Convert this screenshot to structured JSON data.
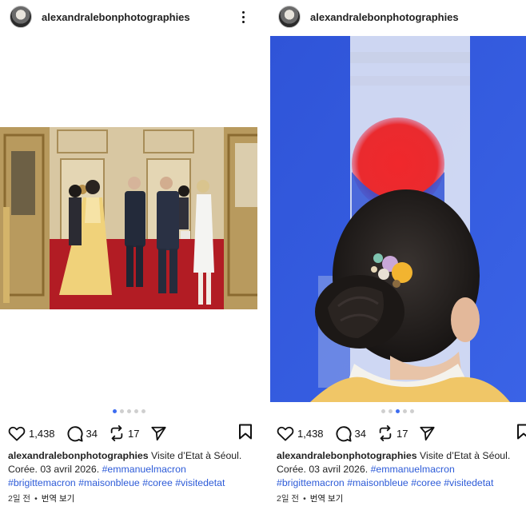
{
  "posts": [
    {
      "username": "alexandralebonphotographies",
      "likes": "1,438",
      "comments": "34",
      "reposts": "17",
      "caption_text": " Visite d’Etat à Séoul. Corée. 03 avril 2026. ",
      "hashtags": [
        "#emmanuelmacron",
        "#brigittemacron",
        "#maisonbleue",
        "#coree",
        "#visitedetat"
      ],
      "time_ago": "2일 전",
      "translate_label": "번역 보기",
      "carousel_total": 5,
      "carousel_active": 0
    },
    {
      "username": "alexandralebonphotographies",
      "likes": "1,438",
      "comments": "34",
      "reposts": "17",
      "caption_text": " Visite d’Etat à Séoul. Corée. 03 avril 2026. ",
      "hashtags": [
        "#emmanuelmacron",
        "#brigittemacron",
        "#maisonbleue",
        "#coree",
        "#visitedetat"
      ],
      "time_ago": "2일 전",
      "translate_label": "번역 보기",
      "carousel_total": 5,
      "carousel_active": 2
    }
  ],
  "colors": {
    "hashtag": "#2d5bd8",
    "carousel_active": "#3d6cf0"
  },
  "icons": [
    "more-options-icon",
    "heart-icon",
    "comment-icon",
    "repost-icon",
    "share-icon",
    "bookmark-icon"
  ]
}
